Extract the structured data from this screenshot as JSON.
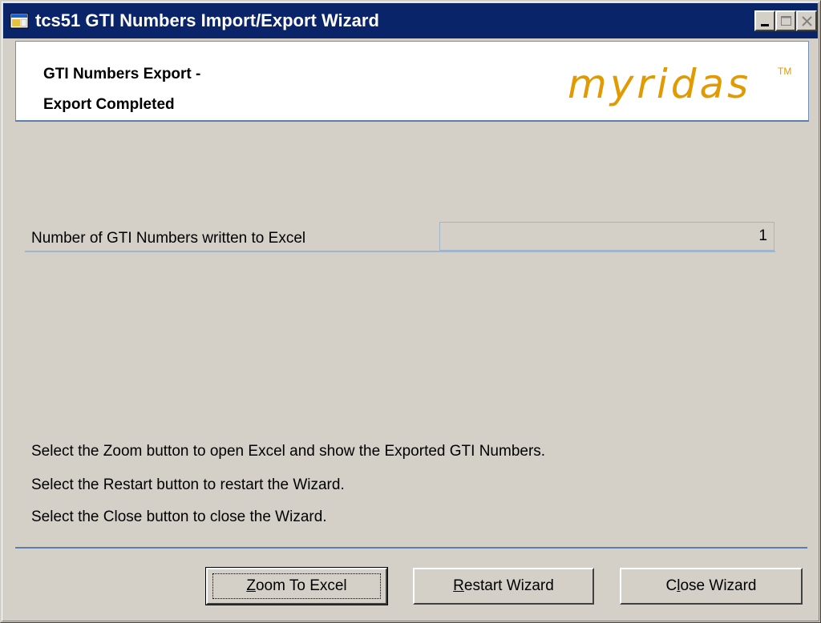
{
  "window": {
    "title": "tcs51 GTI Numbers Import/Export Wizard",
    "title_bar_color": "#0a246a"
  },
  "header": {
    "title_line1": "GTI Numbers Export -",
    "title_line2": "Export Completed",
    "logo_text": "myridas",
    "logo_tm": "TM",
    "logo_color": "#e19a00"
  },
  "summary": {
    "label": "Number of GTI Numbers written to Excel",
    "value": "1"
  },
  "instructions": [
    "Select the Zoom button to open Excel and show the Exported GTI Numbers.",
    "Select the Restart button to restart the Wizard.",
    "Select the Close button to close the Wizard."
  ],
  "buttons": {
    "zoom": {
      "mnemonic": "Z",
      "rest": "oom To Excel"
    },
    "restart": {
      "mnemonic": "R",
      "rest": "estart Wizard"
    },
    "close": {
      "pre": "C",
      "mnemonic": "l",
      "rest": "ose Wizard"
    }
  }
}
